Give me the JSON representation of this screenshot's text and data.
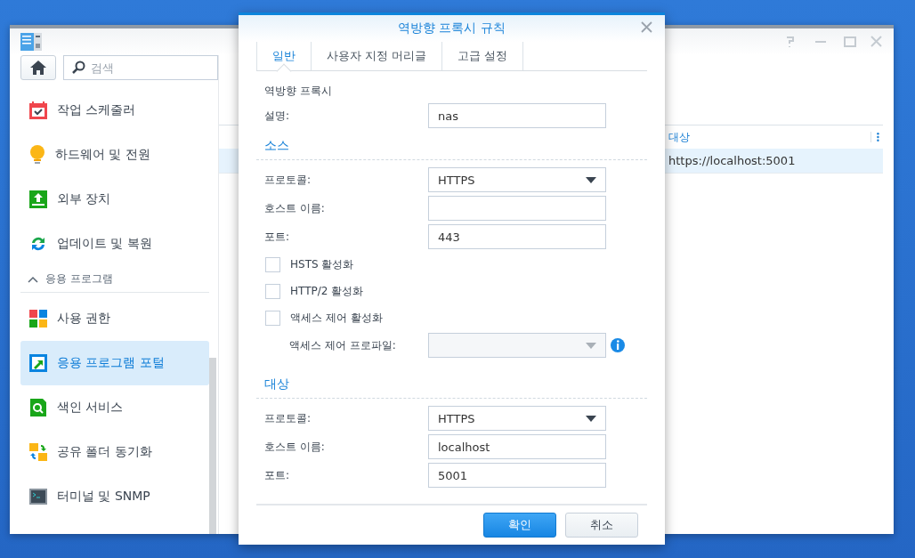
{
  "window": {
    "search": {
      "placeholder": "검색"
    },
    "sidebar": {
      "items": [
        {
          "label": "작업 스케줄러",
          "selected": false
        },
        {
          "label": "하드웨어 및 전원",
          "selected": false
        },
        {
          "label": "외부 장치",
          "selected": false
        },
        {
          "label": "업데이트 및 복원",
          "selected": false
        }
      ],
      "section": {
        "label": "응용 프로그램",
        "expanded": true,
        "items": [
          {
            "label": "사용 권한",
            "selected": false
          },
          {
            "label": "응용 프로그램 포털",
            "selected": true
          },
          {
            "label": "색인 서비스",
            "selected": false
          },
          {
            "label": "공유 폴더 동기화",
            "selected": false
          },
          {
            "label": "터미널 및 SNMP",
            "selected": false
          }
        ]
      }
    },
    "table": {
      "columns": [
        {
          "label": "대상"
        }
      ],
      "rows": [
        {
          "cells": [
            "https://localhost:5001"
          ],
          "selected": true
        }
      ]
    }
  },
  "dialog": {
    "title": "역방향 프록시 규칙",
    "tabs": [
      {
        "label": "일반",
        "selected": true
      },
      {
        "label": "사용자 지정 머리글",
        "selected": false
      },
      {
        "label": "고급 설정",
        "selected": false
      }
    ],
    "heading": "역방향 프록시",
    "description": {
      "label": "설명:",
      "value": "nas"
    },
    "sections": [
      {
        "title": "소스",
        "rows": [
          {
            "kind": "select",
            "label": "프로토콜:",
            "value": "HTTPS",
            "disabled": false
          },
          {
            "kind": "text",
            "label": "호스트 이름:"
          },
          {
            "kind": "text",
            "label": "포트:",
            "value": "443"
          },
          {
            "kind": "checkbox",
            "label": "HSTS 활성화",
            "checked": false
          },
          {
            "kind": "checkbox",
            "label": "HTTP/2 활성화",
            "checked": false
          },
          {
            "kind": "checkbox",
            "label": "액세스 제어 활성화",
            "checked": false
          },
          {
            "kind": "subselect",
            "label": "액세스 제어 프로파일:",
            "disabled": true
          }
        ]
      },
      {
        "title": "대상",
        "rows": [
          {
            "kind": "select",
            "label": "프로토콜:",
            "value": "HTTPS",
            "disabled": false
          },
          {
            "kind": "text",
            "label": "호스트 이름:",
            "value": "localhost"
          },
          {
            "kind": "text",
            "label": "포트:",
            "value": "5001"
          }
        ]
      }
    ],
    "buttons": [
      {
        "label": "확인",
        "kind": "primary"
      },
      {
        "label": "취소",
        "kind": "secondary"
      }
    ]
  }
}
